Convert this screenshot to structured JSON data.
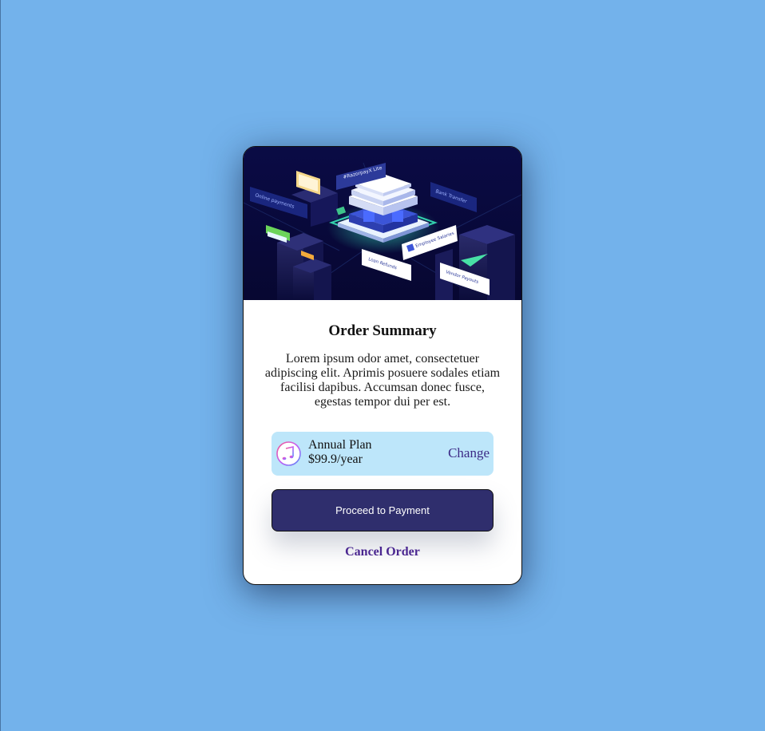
{
  "colors": {
    "page_background": "#73b2eb",
    "card_background": "#ffffff",
    "hero_background": "#08093a",
    "plan_background": "#bde6fa",
    "button_background": "#2f2e6d",
    "link_color": "#4a2690"
  },
  "hero": {
    "illustration": "isometric-payments-illustration",
    "labels": {
      "brand": "#RazorpayX Lite",
      "online_payments": "Online payments",
      "bank_transfer": "Bank Transfer",
      "employee_salaries": "Employee Salaries",
      "loan_refunds": "Loan Refunds",
      "vendor_payouts": "Vendor Payouts"
    }
  },
  "summary": {
    "title": "Order Summary",
    "description": "Lorem ipsum odor amet, consectetuer adipiscing elit. Aprimis posuere sodales etiam facilisi dapibus. Accumsan donec fusce, egestas tempor dui per est."
  },
  "plan": {
    "icon": "music-note-icon",
    "name": "Annual Plan",
    "price": "$99.9/year",
    "change_label": "Change"
  },
  "actions": {
    "proceed_label": "Proceed to Payment",
    "cancel_label": "Cancel Order"
  }
}
